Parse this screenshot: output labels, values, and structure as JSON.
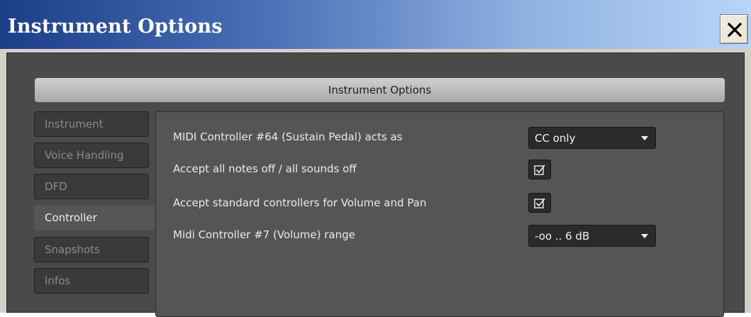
{
  "window": {
    "title": "Instrument Options",
    "close_label": "✕"
  },
  "header": {
    "title": "Instrument Options"
  },
  "tabs": [
    {
      "label": "Instrument",
      "active": false
    },
    {
      "label": "Voice Handling",
      "active": false
    },
    {
      "label": "DFD",
      "active": false
    },
    {
      "label": "Controller",
      "active": true
    },
    {
      "label": "Snapshots",
      "active": false
    },
    {
      "label": "Infos",
      "active": false
    }
  ],
  "options": {
    "sustain": {
      "label": "MIDI Controller #64 (Sustain Pedal) acts as",
      "value": "CC only"
    },
    "notes_off": {
      "label": "Accept all notes off / all sounds off",
      "checked": true
    },
    "std_controllers": {
      "label": "Accept standard controllers for Volume and Pan",
      "checked": true
    },
    "volume_range": {
      "label": "Midi Controller #7 (Volume) range",
      "value": "-oo .. 6 dB"
    }
  },
  "colors": {
    "panel_bg": "#4a4a4a",
    "content_bg": "#555555",
    "tab_bg": "#3a3a3a",
    "active_tab_text": "#f0f0f0",
    "inactive_tab_text": "#8a8a8a"
  }
}
